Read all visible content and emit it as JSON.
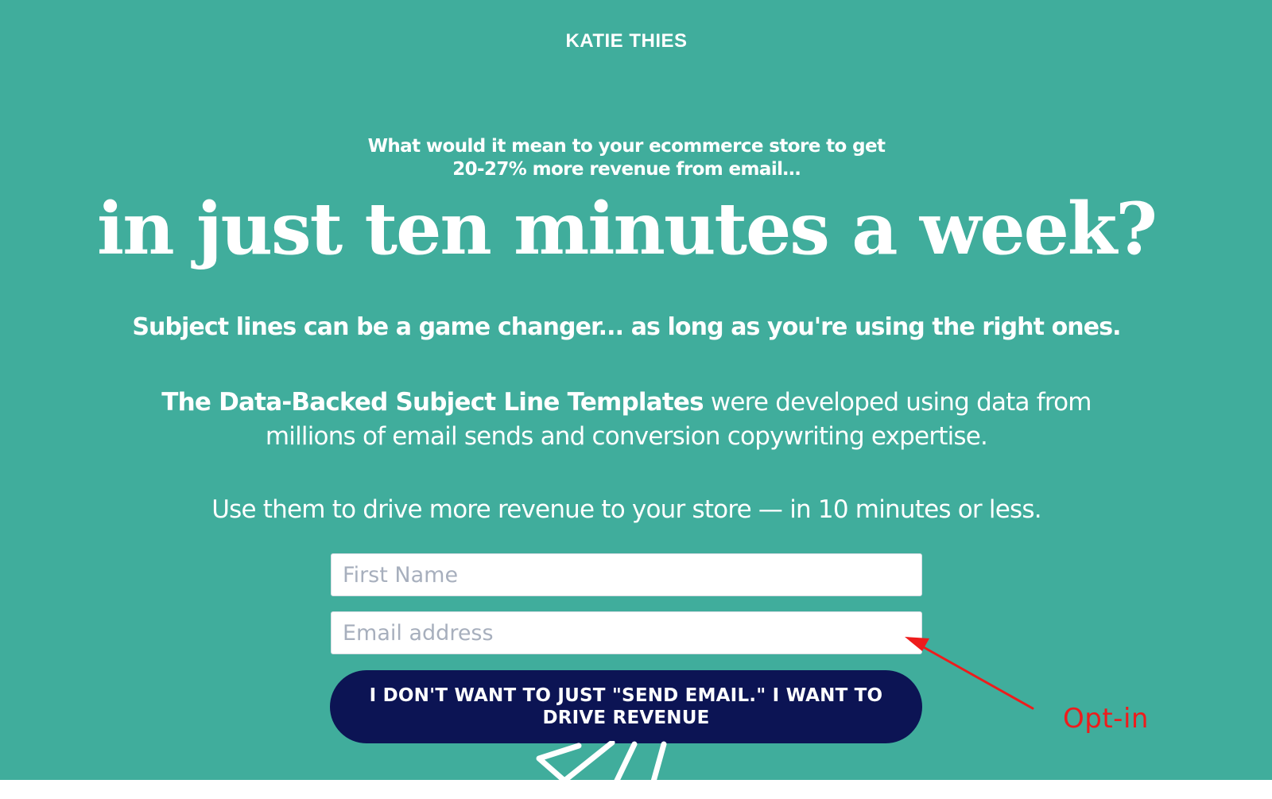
{
  "brand": {
    "name": "KATIE THIES"
  },
  "hero": {
    "pre_headline_line1": "What would it mean to your ecommerce store to get",
    "pre_headline_line2": "20-27% more revenue from email…",
    "headline": "in just ten minutes a week?",
    "subhead": "Subject lines can be a game changer... as long as you're using the right ones.",
    "description_bold": "The Data-Backed Subject Line Templates",
    "description_rest": " were developed using data from",
    "description_line2": "millions of email sends and conversion copywriting expertise.",
    "usage": "Use them to drive more revenue to your store — in 10 minutes or less."
  },
  "form": {
    "first_name_placeholder": "First Name",
    "email_placeholder": "Email address",
    "first_name_value": "",
    "email_value": "",
    "submit_label": "I DON'T WANT TO JUST \"SEND EMAIL.\" I WANT TO DRIVE REVENUE"
  },
  "annotation": {
    "label": "Opt-in"
  },
  "colors": {
    "background": "#40ad9c",
    "button": "#0c1454",
    "annotation": "#ee1c1c",
    "text": "#ffffff"
  },
  "icons": {
    "arrow": "annotation-arrow-icon",
    "paper_plane": "paper-plane-icon"
  }
}
